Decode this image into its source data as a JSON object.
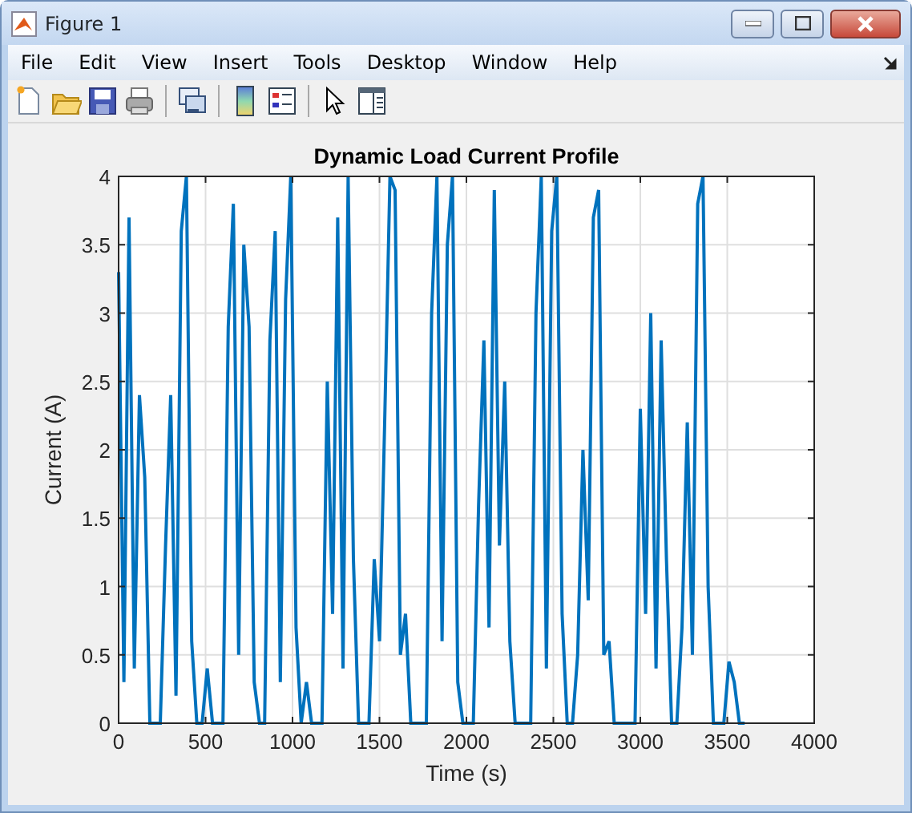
{
  "window": {
    "title": "Figure 1"
  },
  "menu": [
    "File",
    "Edit",
    "View",
    "Insert",
    "Tools",
    "Desktop",
    "Window",
    "Help"
  ],
  "toolbar": [
    {
      "kind": "new"
    },
    {
      "kind": "open"
    },
    {
      "kind": "save"
    },
    {
      "kind": "print"
    },
    {
      "kind": "sep"
    },
    {
      "kind": "link"
    },
    {
      "kind": "sep"
    },
    {
      "kind": "colorbar"
    },
    {
      "kind": "legend"
    },
    {
      "kind": "sep"
    },
    {
      "kind": "pointer"
    },
    {
      "kind": "inspector"
    }
  ],
  "figure": {
    "chart_data": {
      "type": "line",
      "grid": true,
      "title": "Dynamic Load Current Profile",
      "xlabel": "Time (s)",
      "ylabel": "Current (A)",
      "xlim": [
        0,
        4000
      ],
      "ylim": [
        0,
        4
      ],
      "xticks": [
        0,
        500,
        1000,
        1500,
        2000,
        2500,
        3000,
        3500,
        4000
      ],
      "yticks": [
        0,
        0.5,
        1,
        1.5,
        2,
        2.5,
        3,
        3.5,
        4
      ],
      "x": [
        0,
        30,
        60,
        90,
        120,
        150,
        180,
        210,
        240,
        270,
        300,
        330,
        360,
        390,
        420,
        450,
        480,
        510,
        540,
        570,
        600,
        630,
        660,
        690,
        720,
        750,
        780,
        810,
        840,
        870,
        900,
        930,
        960,
        990,
        1020,
        1050,
        1080,
        1110,
        1140,
        1170,
        1200,
        1230,
        1260,
        1290,
        1320,
        1350,
        1380,
        1410,
        1440,
        1470,
        1500,
        1530,
        1560,
        1590,
        1620,
        1650,
        1680,
        1710,
        1740,
        1770,
        1800,
        1830,
        1860,
        1890,
        1920,
        1950,
        1980,
        2010,
        2040,
        2070,
        2100,
        2130,
        2160,
        2190,
        2220,
        2250,
        2280,
        2310,
        2340,
        2370,
        2400,
        2430,
        2460,
        2490,
        2520,
        2550,
        2580,
        2610,
        2640,
        2670,
        2700,
        2730,
        2760,
        2790,
        2820,
        2850,
        2880,
        2910,
        2940,
        2970,
        3000,
        3030,
        3060,
        3090,
        3120,
        3150,
        3180,
        3210,
        3240,
        3270,
        3300,
        3330,
        3360,
        3390,
        3420,
        3450,
        3480,
        3510,
        3540,
        3570,
        3600
      ],
      "series": [
        {
          "color": "#0072bd",
          "values": [
            3.3,
            0.3,
            3.7,
            0.4,
            2.4,
            1.8,
            0,
            0,
            0,
            1.3,
            2.4,
            0.2,
            3.6,
            4.0,
            0.6,
            0,
            0,
            0.4,
            0,
            0,
            0,
            2.9,
            3.8,
            0.5,
            3.5,
            2.9,
            0.3,
            0,
            0,
            2.8,
            3.6,
            0.3,
            3.1,
            4.0,
            0.7,
            0,
            0.3,
            0,
            0,
            0,
            2.5,
            0.8,
            3.7,
            0.4,
            4.0,
            1.2,
            0,
            0,
            0,
            1.2,
            0.6,
            2.2,
            4.0,
            3.9,
            0.5,
            0.8,
            0,
            0,
            0,
            0,
            3.0,
            4.0,
            0.6,
            3.5,
            4.0,
            0.3,
            0,
            0,
            0,
            1.6,
            2.8,
            0.7,
            3.9,
            1.3,
            2.5,
            0.6,
            0,
            0,
            0,
            0,
            3.0,
            4.0,
            0.4,
            3.6,
            4.0,
            0.8,
            0,
            0,
            0.5,
            2.0,
            0.9,
            3.7,
            3.9,
            0.5,
            0.6,
            0,
            0,
            0,
            0,
            0,
            2.3,
            0.8,
            3.0,
            0.4,
            2.8,
            1.2,
            0,
            0,
            0.7,
            2.2,
            0.5,
            3.8,
            4.0,
            1.0,
            0,
            0,
            0,
            0.45,
            0.3,
            0,
            0
          ]
        }
      ]
    }
  }
}
